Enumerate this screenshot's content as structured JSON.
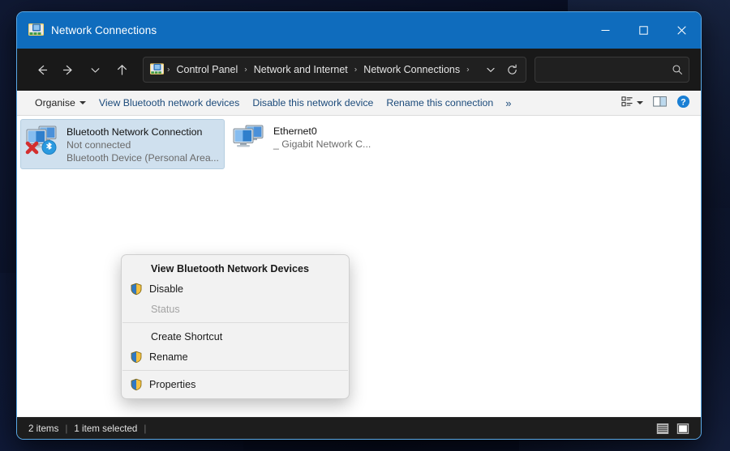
{
  "window": {
    "title": "Network Connections",
    "icon": "network-connections-icon",
    "caption": {
      "minimize_label": "Minimise",
      "maximize_label": "Maximise",
      "close_label": "Close"
    }
  },
  "navbar": {
    "back_label": "Back",
    "forward_label": "Forward",
    "recent_label": "Recent locations",
    "up_label": "Up",
    "breadcrumb": [
      "Control Panel",
      "Network and Internet",
      "Network Connections"
    ],
    "breadcrumb_separator": "›",
    "dropdown_label": "Previous locations",
    "refresh_label": "Refresh",
    "search": {
      "value": "",
      "placeholder": "",
      "icon": "search-icon"
    }
  },
  "commandbar": {
    "organise_label": "Organise",
    "items": [
      "View Bluetooth network devices",
      "Disable this network device",
      "Rename this connection"
    ],
    "overflow_label": "»",
    "view_options_label": "View options",
    "preview_pane_label": "Preview pane",
    "help_label": "?"
  },
  "connections": [
    {
      "name": "Bluetooth Network Connection",
      "status": "Not connected",
      "device": "Bluetooth Device (Personal Area...",
      "selected": true,
      "icon": "bluetooth-network-adapter-icon"
    },
    {
      "name": "Ethernet0",
      "status": "",
      "device": "Gigabit Network C...",
      "device_prefix": "_",
      "selected": false,
      "icon": "ethernet-adapter-icon"
    }
  ],
  "context_menu": {
    "items": [
      {
        "label": "View Bluetooth Network Devices",
        "bold": true,
        "icon": "none",
        "disabled": false
      },
      {
        "label": "Disable",
        "bold": false,
        "icon": "shield",
        "disabled": false
      },
      {
        "label": "Status",
        "bold": false,
        "icon": "none",
        "disabled": true
      },
      {
        "separator": true
      },
      {
        "label": "Create Shortcut",
        "bold": false,
        "icon": "none",
        "disabled": false
      },
      {
        "label": "Rename",
        "bold": false,
        "icon": "shield",
        "disabled": false
      },
      {
        "separator": true
      },
      {
        "label": "Properties",
        "bold": false,
        "icon": "shield",
        "disabled": false
      }
    ]
  },
  "statusbar": {
    "item_count": "2 items",
    "selection": "1 item selected",
    "separator": "|",
    "details_view_label": "Details view",
    "large_icons_view_label": "Large icons view"
  },
  "colors": {
    "titlebar": "#0f6cbd",
    "window_border": "#5aa9e6",
    "command_link": "#1b4a7a",
    "selection": "#cfe0ee",
    "help_blue": "#1a7fd4",
    "desktop": "#0b1020"
  }
}
